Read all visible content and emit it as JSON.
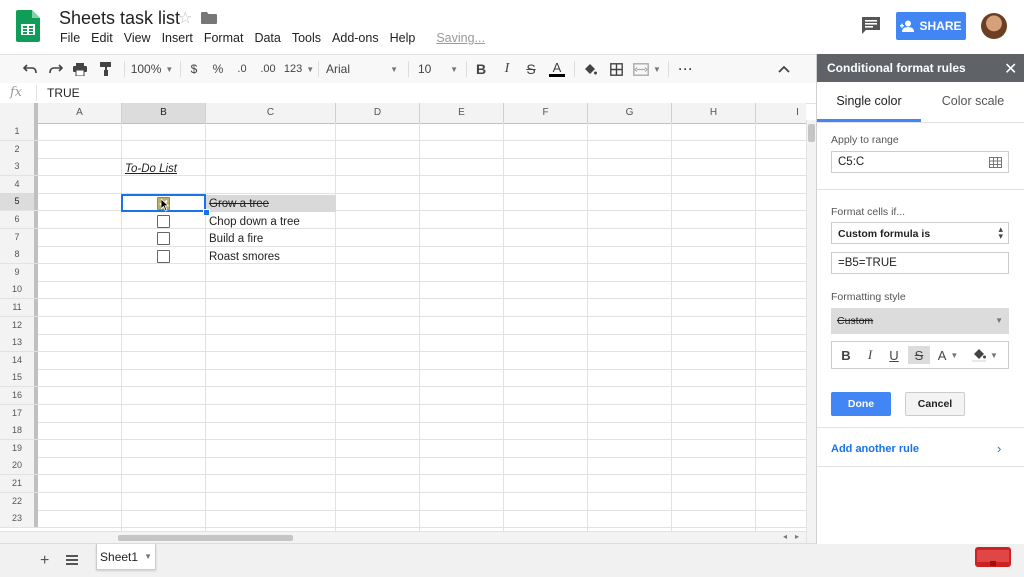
{
  "header": {
    "doc_title": "Sheets task list",
    "menu": [
      "File",
      "Edit",
      "View",
      "Insert",
      "Format",
      "Data",
      "Tools",
      "Add-ons",
      "Help"
    ],
    "saving_status": "Saving...",
    "share_label": "SHARE"
  },
  "toolbar": {
    "zoom": "100%",
    "currency": "$",
    "percent": "%",
    "decrease_decimals": ".0",
    "increase_decimals": ".00",
    "more_formats": "123",
    "font": "Arial",
    "font_size": "10",
    "bold": "B",
    "italic": "I",
    "strikethrough": "S",
    "text_color": "A",
    "more": "···"
  },
  "formula_bar": {
    "fx": "fx",
    "value": "TRUE"
  },
  "grid": {
    "columns": [
      "A",
      "B",
      "C",
      "D",
      "E",
      "F",
      "G",
      "H",
      "I"
    ],
    "rows": [
      "1",
      "2",
      "3",
      "4",
      "5",
      "6",
      "7",
      "8",
      "9",
      "10",
      "11",
      "12",
      "13",
      "14",
      "15",
      "16",
      "17",
      "18",
      "19",
      "20",
      "21",
      "22",
      "23"
    ],
    "title_cell": "To-Do List",
    "tasks": [
      {
        "label": "Grow a tree",
        "checked": true
      },
      {
        "label": "Chop down a tree",
        "checked": false
      },
      {
        "label": "Build a fire",
        "checked": false
      },
      {
        "label": "Roast smores",
        "checked": false
      }
    ]
  },
  "sheet_tabs": {
    "add": "+",
    "tabs": [
      "Sheet1"
    ]
  },
  "panel": {
    "title": "Conditional format rules",
    "tab_single": "Single color",
    "tab_scale": "Color scale",
    "apply_label": "Apply to range",
    "apply_value": "C5:C",
    "format_if_label": "Format cells if...",
    "condition": "Custom formula is",
    "formula": "=B5=TRUE",
    "style_label": "Formatting style",
    "style_preview": "Custom",
    "style_bold": "B",
    "style_italic": "I",
    "style_underline": "U",
    "style_strike": "S",
    "style_text_color": "A",
    "done": "Done",
    "cancel": "Cancel",
    "add_rule": "Add another rule"
  },
  "colors": {
    "accent": "#4285f4",
    "sheets_green": "#0f9d58",
    "panel_header": "#5f6368",
    "selection": "#1a73e8"
  }
}
